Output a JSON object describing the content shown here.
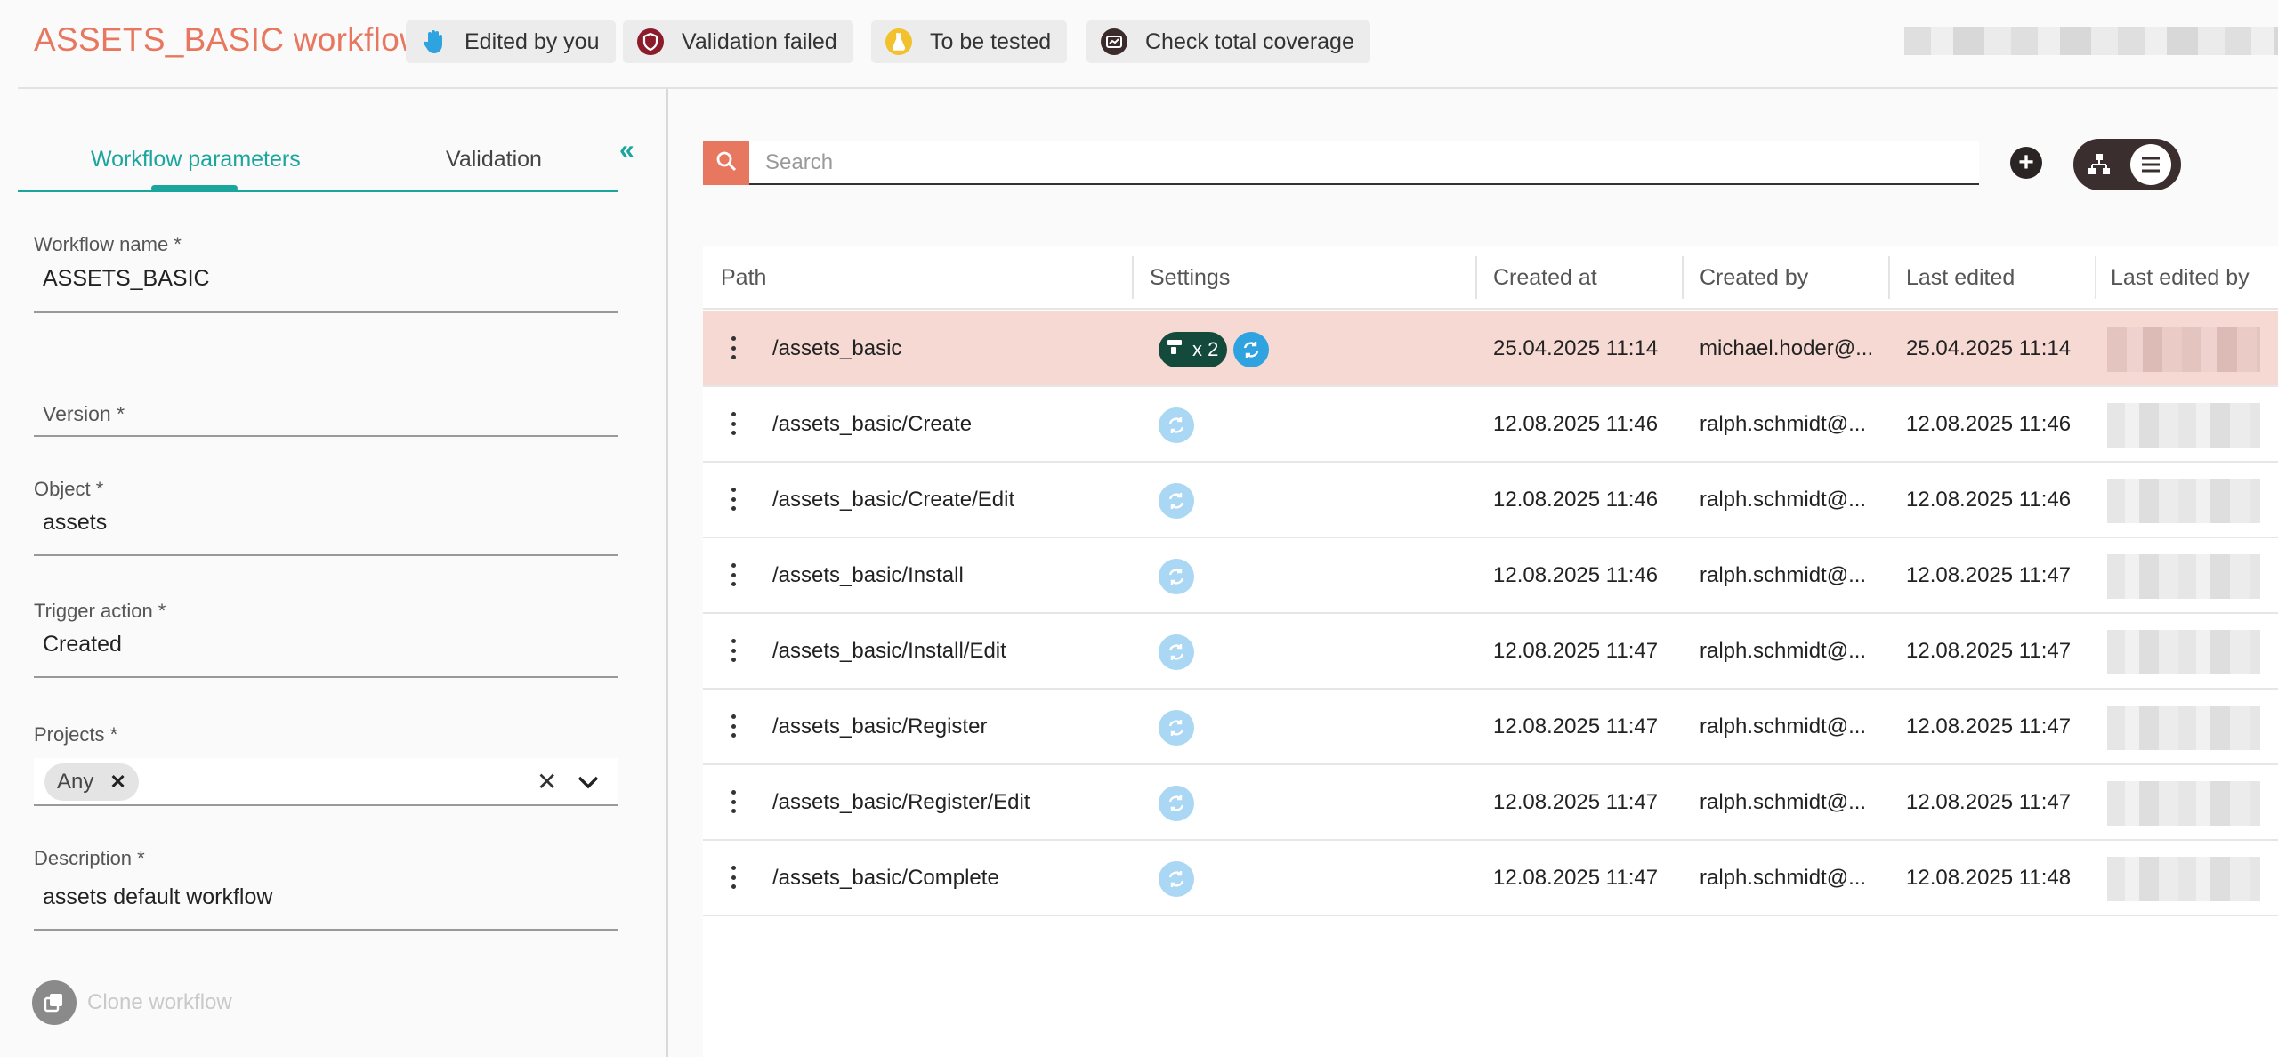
{
  "header": {
    "title": "ASSETS_BASIC workflow",
    "chips": [
      {
        "label": "Edited by you",
        "icon": "hand-icon"
      },
      {
        "label": "Validation failed",
        "icon": "shield-icon",
        "color": "#8c1c2c"
      },
      {
        "label": "To be tested",
        "icon": "flask-icon",
        "color": "#f2c12e"
      },
      {
        "label": "Check total coverage",
        "icon": "coverage-icon"
      }
    ]
  },
  "left_panel": {
    "tabs": [
      {
        "label": "Workflow parameters",
        "active": true
      },
      {
        "label": "Validation",
        "active": false
      }
    ],
    "fields": {
      "name": {
        "label": "Workflow name *",
        "value": "ASSETS_BASIC"
      },
      "version": {
        "label": "Version *",
        "value": ""
      },
      "object": {
        "label": "Object *",
        "value": "assets"
      },
      "trigger": {
        "label": "Trigger action *",
        "value": "Created"
      },
      "projects": {
        "label": "Projects *",
        "chips": [
          "Any"
        ]
      },
      "description": {
        "label": "Description *",
        "value": "assets default workflow"
      }
    },
    "clone_label": "Clone workflow"
  },
  "search": {
    "placeholder": "Search"
  },
  "table": {
    "columns": [
      "Path",
      "Settings",
      "Created at",
      "Created by",
      "Last edited",
      "Last edited by"
    ],
    "rows": [
      {
        "path": "/assets_basic",
        "settings_count": "x 2",
        "created_at": "25.04.2025 11:14",
        "created_by": "michael.hoder@...",
        "last_edited": "25.04.2025 11:14",
        "status": "validation-failed"
      },
      {
        "path": "/assets_basic/Create",
        "created_at": "12.08.2025 11:46",
        "created_by": "ralph.schmidt@...",
        "last_edited": "12.08.2025 11:46"
      },
      {
        "path": "/assets_basic/Create/Edit",
        "created_at": "12.08.2025 11:46",
        "created_by": "ralph.schmidt@...",
        "last_edited": "12.08.2025 11:46"
      },
      {
        "path": "/assets_basic/Install",
        "created_at": "12.08.2025 11:46",
        "created_by": "ralph.schmidt@...",
        "last_edited": "12.08.2025 11:47"
      },
      {
        "path": "/assets_basic/Install/Edit",
        "created_at": "12.08.2025 11:47",
        "created_by": "ralph.schmidt@...",
        "last_edited": "12.08.2025 11:47"
      },
      {
        "path": "/assets_basic/Register",
        "created_at": "12.08.2025 11:47",
        "created_by": "ralph.schmidt@...",
        "last_edited": "12.08.2025 11:47"
      },
      {
        "path": "/assets_basic/Register/Edit",
        "created_at": "12.08.2025 11:47",
        "created_by": "ralph.schmidt@...",
        "last_edited": "12.08.2025 11:47"
      },
      {
        "path": "/assets_basic/Complete",
        "created_at": "12.08.2025 11:47",
        "created_by": "ralph.schmidt@...",
        "last_edited": "12.08.2025 11:48"
      }
    ]
  },
  "colors": {
    "brand": "#e8775f",
    "accent": "#1aa59d",
    "failed_row": "#f7d9d3",
    "sync": "#2ea3e0"
  }
}
